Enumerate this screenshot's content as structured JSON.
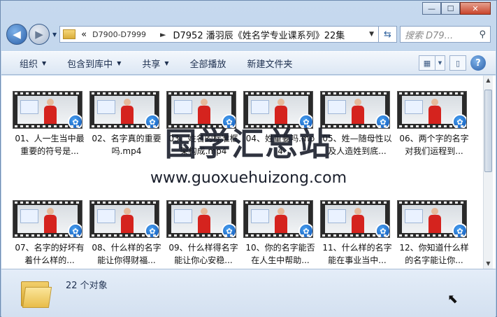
{
  "window": {
    "caption": {
      "minimize": "—",
      "maximize": "☐",
      "close": "✕"
    }
  },
  "address": {
    "overflow": "«",
    "crumbs": [
      "D7900-D7999",
      "D7952 潘羽辰《姓名学专业课系列》22集"
    ],
    "separator": "►",
    "search_placeholder": "搜索 D79..."
  },
  "toolbar": {
    "items": [
      "组织",
      "包含到库中",
      "共享",
      "全部播放",
      "新建文件夹"
    ]
  },
  "files": [
    {
      "label": "01、人一生当中最重要的符号是..."
    },
    {
      "label": "02、名字真的重要吗.mp4"
    },
    {
      "label": "03、姓名的标准框架构成.mp4"
    },
    {
      "label": "04、姓重要吗.mp4"
    },
    {
      "label": "05、姓—随母性以及人造姓到底..."
    },
    {
      "label": "06、两个字的名字对我们运程到..."
    },
    {
      "label": "07、名字的好坏有着什么样的..."
    },
    {
      "label": "08、什么样的名字能让你得财福..."
    },
    {
      "label": "09、什么样得名字能让你心安稳..."
    },
    {
      "label": "10、你的名字能否在人生中帮助..."
    },
    {
      "label": "11、什么样的名字能在事业当中..."
    },
    {
      "label": "12、你知道什么样的名字能让你..."
    }
  ],
  "watermark": {
    "cn": "国学汇总站",
    "url": "www.guoxuehuizong.com"
  },
  "status": {
    "count": "22 个对象"
  },
  "icons": {
    "play_badge": "film-reel-icon"
  }
}
